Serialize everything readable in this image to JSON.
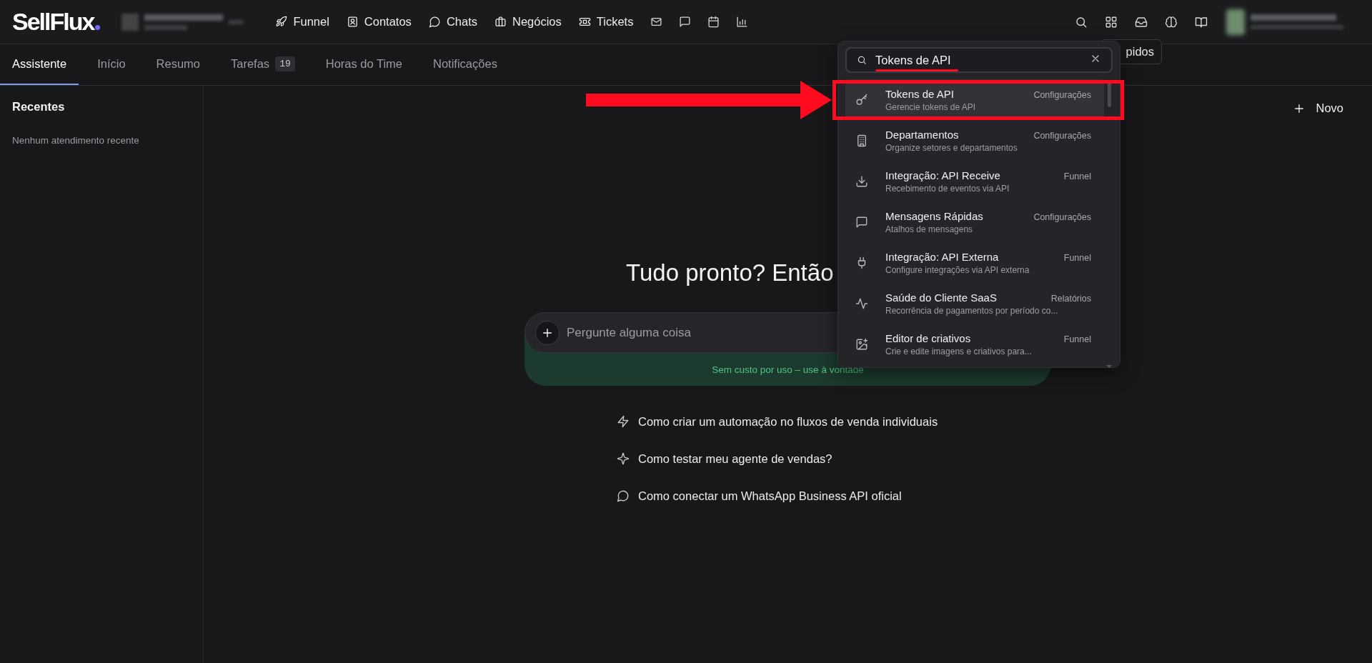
{
  "header": {
    "logo": "SellFlux",
    "nav": [
      {
        "label": "Funnel"
      },
      {
        "label": "Contatos"
      },
      {
        "label": "Chats"
      },
      {
        "label": "Negócios"
      },
      {
        "label": "Tickets"
      }
    ]
  },
  "tabs": [
    {
      "label": "Assistente",
      "selected": true
    },
    {
      "label": "Início",
      "selected": false
    },
    {
      "label": "Resumo",
      "selected": false
    },
    {
      "label": "Tarefas",
      "badge": "19",
      "selected": false
    },
    {
      "label": "Horas do Time",
      "selected": false
    },
    {
      "label": "Notificações",
      "selected": false
    }
  ],
  "sidebar": {
    "title": "Recentes",
    "empty_text": "Nenhum atendimento recente"
  },
  "new_button": "Novo",
  "assistant": {
    "heading": "Tudo pronto? Então",
    "placeholder": "Pergunte alguma coisa",
    "notice": "Sem custo por uso – use à vontade",
    "suggestions": [
      "Como criar um automação no fluxos de venda individuais",
      "Como testar meu agente de vendas?",
      "Como conectar um WhatsApp Business API oficial"
    ]
  },
  "tooltip": "pidos",
  "search": {
    "value": "Tokens de API",
    "results": [
      {
        "title": "Tokens de API",
        "subtitle": "Gerencie tokens de API",
        "category": "Configurações",
        "selected": true
      },
      {
        "title": "Departamentos",
        "subtitle": "Organize setores e departamentos",
        "category": "Configurações",
        "selected": false
      },
      {
        "title": "Integração: API Receive",
        "subtitle": "Recebimento de eventos via API",
        "category": "Funnel",
        "selected": false
      },
      {
        "title": "Mensagens Rápidas",
        "subtitle": "Atalhos de mensagens",
        "category": "Configurações",
        "selected": false
      },
      {
        "title": "Integração: API Externa",
        "subtitle": "Configure integrações via API externa",
        "category": "Funnel",
        "selected": false
      },
      {
        "title": "Saúde do Cliente SaaS",
        "subtitle": "Recorrência de pagamentos por período co...",
        "category": "Relatórios",
        "selected": false
      },
      {
        "title": "Editor de criativos",
        "subtitle": "Crie e edite imagens e criativos para...",
        "category": "Funnel",
        "selected": false
      }
    ]
  }
}
